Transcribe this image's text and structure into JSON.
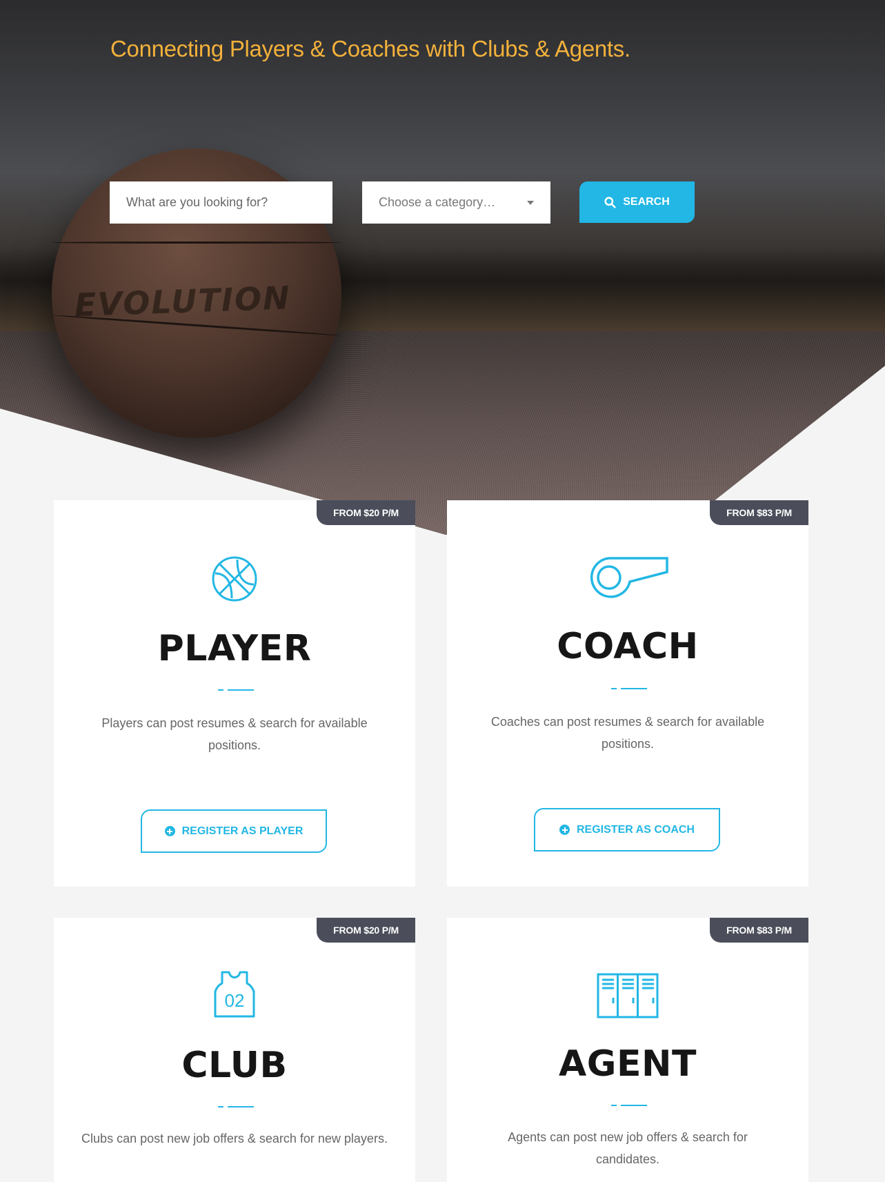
{
  "hero": {
    "title": "Connecting Players & Coaches with Clubs & Agents.",
    "ball_brand": "EVOLUTION"
  },
  "search": {
    "placeholder": "What are you looking for?",
    "category_placeholder": "Choose a category…",
    "button_label": "SEARCH",
    "button_icon": "search-icon"
  },
  "cards": [
    {
      "badge": "FROM $20 P/M",
      "icon": "basketball-icon",
      "title": "PLAYER",
      "text": "Players can post resumes & search for available positions.",
      "button_label": "REGISTER AS PLAYER"
    },
    {
      "badge": "FROM $83 P/M",
      "icon": "whistle-icon",
      "title": "COACH",
      "text": "Coaches can post resumes & search for available positions.",
      "button_label": "REGISTER AS COACH"
    },
    {
      "badge": "FROM $20 P/M",
      "icon": "jersey-icon",
      "jersey_number": "02",
      "title": "CLUB",
      "text": "Clubs can post new job offers & search for new players."
    },
    {
      "badge": "FROM $83 P/M",
      "icon": "lockers-icon",
      "title": "AGENT",
      "text": "Agents can post new job offers & search for candidates."
    }
  ],
  "colors": {
    "accent": "#22b7e4",
    "hero_title": "#f3b13b",
    "badge_bg": "#4b4e5a",
    "page_bg": "#f4f4f4",
    "heading": "#161616"
  }
}
